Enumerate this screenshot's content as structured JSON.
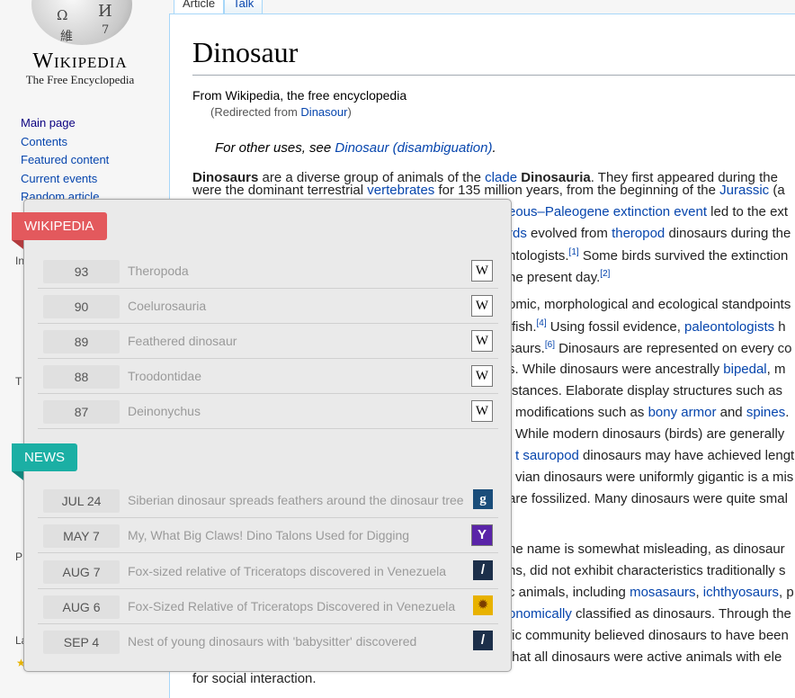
{
  "sidebar": {
    "logo_glyphs": [
      "Ω",
      "И",
      "維",
      "7"
    ],
    "wordmark": "Wikipedia",
    "tagline": "The Free Encyclopedia",
    "nav": [
      {
        "label": "Main page",
        "color": "#0b0080"
      },
      {
        "label": "Contents"
      },
      {
        "label": "Featured content"
      },
      {
        "label": "Current events"
      },
      {
        "label": "Random article"
      }
    ],
    "side_letters": [
      "In",
      "T",
      "P",
      "La"
    ]
  },
  "tabs": [
    "Article",
    "Talk"
  ],
  "article": {
    "title": "Dinosaur",
    "from": "From Wikipedia, the free encyclopedia",
    "redirect_prefix": "(Redirected from ",
    "redirect_link": "Dinasour",
    "redirect_suffix": ")",
    "hatnote_prefix": "For other uses, see ",
    "hatnote_link": "Dinosaur (disambiguation)",
    "hatnote_suffix": ".",
    "lead": {
      "b1": "Dinosaurs",
      "t1": " are a diverse group of animals of the ",
      "l1": "clade",
      "t2": " ",
      "b2": "Dinosauria",
      "t3": ". They first appeared during the"
    },
    "lines": [
      {
        "segs": [
          [
            "t",
            "were the dominant terrestrial "
          ],
          [
            "l",
            "vertebrates"
          ],
          [
            "t",
            " for 135 million years, from the beginning of the "
          ],
          [
            "l",
            "Jurassic"
          ],
          [
            "t",
            " (a"
          ]
        ]
      },
      {
        "segs": [
          [
            "l",
            "eous–Paleogene extinction event"
          ],
          [
            "t",
            " led to the ext"
          ]
        ]
      },
      {
        "segs": [
          [
            "l",
            "rds"
          ],
          [
            "t",
            " evolved from "
          ],
          [
            "l",
            "theropod"
          ],
          [
            "t",
            " dinosaurs during the"
          ]
        ]
      },
      {
        "segs": [
          [
            "t",
            "ntologists."
          ],
          [
            "s",
            "[1]"
          ],
          [
            "t",
            " Some birds survived the extinction"
          ]
        ]
      },
      {
        "segs": [
          [
            "t",
            "he present day."
          ],
          [
            "s",
            "[2]"
          ]
        ]
      },
      {
        "segs": [
          [
            "t",
            "omic, morphological and ecological standpoints"
          ]
        ]
      },
      {
        "segs": [
          [
            "t",
            "fish."
          ],
          [
            "s",
            "[4]"
          ],
          [
            "t",
            " Using fossil evidence, "
          ],
          [
            "l",
            "paleontologists"
          ],
          [
            "t",
            " h"
          ]
        ]
      },
      {
        "segs": [
          [
            "t",
            "saurs."
          ],
          [
            "s",
            "[6]"
          ],
          [
            "t",
            " Dinosaurs are represented on every co"
          ]
        ]
      },
      {
        "segs": [
          [
            "t",
            "s. While dinosaurs were ancestrally "
          ],
          [
            "l",
            "bipedal"
          ],
          [
            "t",
            ", m"
          ]
        ]
      },
      {
        "segs": [
          [
            "t",
            "stances. Elaborate display structures such as"
          ]
        ]
      },
      {
        "segs": [
          [
            "t",
            "modifications such as "
          ],
          [
            "l",
            "bony armor"
          ],
          [
            "t",
            " and "
          ],
          [
            "l",
            "spines"
          ],
          [
            "t",
            "."
          ]
        ]
      },
      {
        "segs": [
          [
            "t",
            "While modern dinosaurs (birds) are generally"
          ]
        ]
      },
      {
        "segs": [
          [
            "l",
            "t sauropod"
          ],
          [
            "t",
            " dinosaurs may have achieved lengt"
          ]
        ]
      },
      {
        "segs": [
          [
            "t",
            "vian dinosaurs were uniformly gigantic is a mis"
          ]
        ]
      },
      {
        "segs": [
          [
            "t",
            "are fossilized. Many dinosaurs were quite smal"
          ]
        ]
      },
      {
        "segs": [
          [
            "t",
            "he name is somewhat misleading, as dinosaur"
          ]
        ]
      },
      {
        "segs": [
          [
            "t",
            "ns, did not exhibit characteristics traditionally s"
          ]
        ]
      },
      {
        "segs": [
          [
            "t",
            "c animals, including "
          ],
          [
            "l",
            "mosasaurs"
          ],
          [
            "t",
            ", "
          ],
          [
            "l",
            "ichthyosaurs"
          ],
          [
            "t",
            ", p"
          ]
        ]
      },
      {
        "segs": [
          [
            "l",
            "onomically"
          ],
          [
            "t",
            " classified as dinosaurs. Through the"
          ]
        ]
      },
      {
        "segs": [
          [
            "t",
            "fic community believed dinosaurs to have been"
          ]
        ]
      },
      {
        "segs": [
          [
            "t",
            "that all dinosaurs were active animals with ele"
          ]
        ]
      },
      {
        "segs": [
          [
            "t",
            "for social interaction."
          ]
        ]
      }
    ]
  },
  "popup": {
    "wikipedia_header": "WIKIPEDIA",
    "wikipedia_color": "#e3595d",
    "news_header": "NEWS",
    "news_color": "#1bafa4",
    "wiki_rows": [
      {
        "score": "93",
        "title": "Theropoda",
        "icon": "W"
      },
      {
        "score": "90",
        "title": "Coelurosauria",
        "icon": "W"
      },
      {
        "score": "89",
        "title": "Feathered dinosaur",
        "icon": "W"
      },
      {
        "score": "88",
        "title": "Troodontidae",
        "icon": "W"
      },
      {
        "score": "87",
        "title": "Deinonychus",
        "icon": "W"
      }
    ],
    "news_rows": [
      {
        "date": "JUL 24",
        "title": "Siberian dinosaur spreads feathers around the dinosaur tree",
        "icon": "g",
        "icon_name": "guardian-icon"
      },
      {
        "date": "MAY 7",
        "title": "My, What Big Claws! Dino Talons Used for Digging",
        "icon": "Y",
        "icon_name": "yahoo-icon"
      },
      {
        "date": "AUG 7",
        "title": "Fox-sized relative of Triceratops discovered in Venezuela",
        "icon": "/",
        "icon_name": "slash-news-icon"
      },
      {
        "date": "AUG 6",
        "title": "Fox-Sized Relative of Triceratops Discovered in Venezuela",
        "icon": "✹",
        "icon_name": "sun-news-icon"
      },
      {
        "date": "SEP 4",
        "title": "Nest of young dinosaurs with 'babysitter' discovered",
        "icon": "/",
        "icon_name": "slash-news-icon"
      }
    ]
  }
}
